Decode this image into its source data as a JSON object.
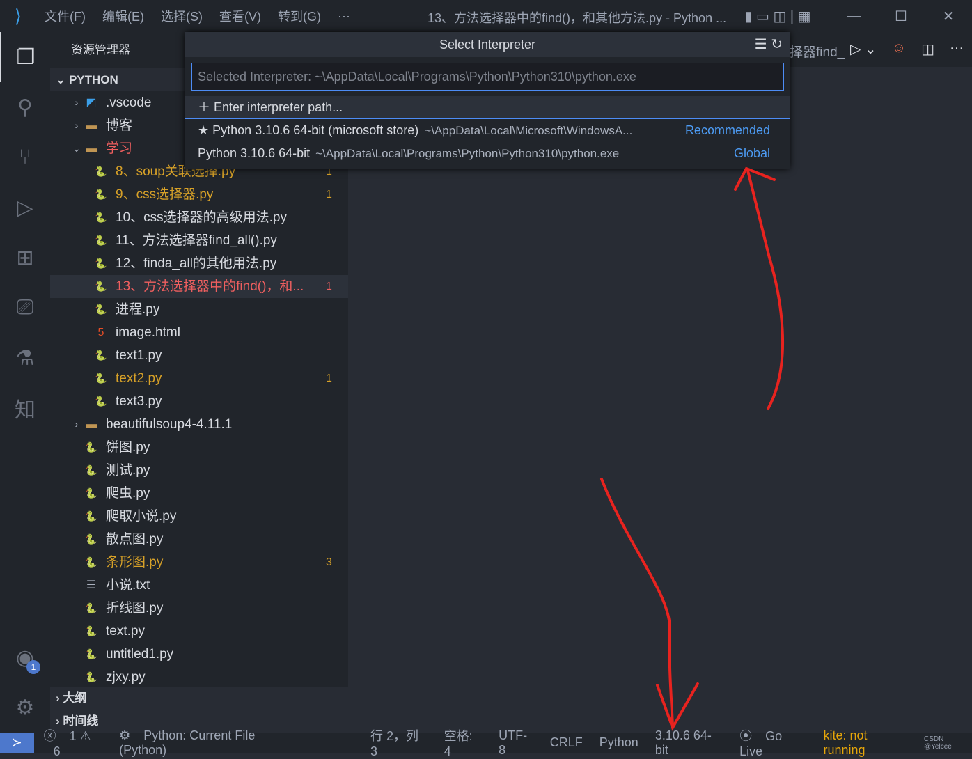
{
  "titlebar": {
    "menus": [
      "文件(F)",
      "编辑(E)",
      "选择(S)",
      "查看(V)",
      "转到(G)",
      "···"
    ],
    "title": "13、方法选择器中的find()，和其他方法.py - Python ..."
  },
  "sidebar": {
    "title": "资源管理器",
    "section": "PYTHON",
    "outline": "大纲",
    "timeline": "时间线",
    "items": [
      {
        "label": ".vscode",
        "type": "folder-vscode",
        "depth": 0,
        "chev": "›"
      },
      {
        "label": "博客",
        "type": "folder",
        "depth": 0,
        "chev": "›"
      },
      {
        "label": "学习",
        "type": "folder-open",
        "depth": 0,
        "chev": "⌄",
        "cls": "err"
      },
      {
        "label": "8、soup关联选择.py",
        "type": "python",
        "depth": 1,
        "badge": "1",
        "cls": "mod"
      },
      {
        "label": "9、css选择器.py",
        "type": "python",
        "depth": 1,
        "badge": "1",
        "cls": "mod"
      },
      {
        "label": "10、css选择器的高级用法.py",
        "type": "python",
        "depth": 1
      },
      {
        "label": "11、方法选择器find_all().py",
        "type": "python",
        "depth": 1
      },
      {
        "label": "12、finda_all的其他用法.py",
        "type": "python",
        "depth": 1
      },
      {
        "label": "13、方法选择器中的find()，和...",
        "type": "python",
        "depth": 1,
        "badge": "1",
        "cls": "err",
        "selected": true
      },
      {
        "label": "进程.py",
        "type": "python",
        "depth": 1
      },
      {
        "label": "image.html",
        "type": "html",
        "depth": 1
      },
      {
        "label": "text1.py",
        "type": "python",
        "depth": 1
      },
      {
        "label": "text2.py",
        "type": "python",
        "depth": 1,
        "badge": "1",
        "cls": "mod"
      },
      {
        "label": "text3.py",
        "type": "python",
        "depth": 1
      },
      {
        "label": "beautifulsoup4-4.11.1",
        "type": "folder",
        "depth": 0,
        "chev": "›"
      },
      {
        "label": "饼图.py",
        "type": "python",
        "depth": 0
      },
      {
        "label": "测试.py",
        "type": "python",
        "depth": 0
      },
      {
        "label": "爬虫.py",
        "type": "python",
        "depth": 0
      },
      {
        "label": "爬取小说.py",
        "type": "python",
        "depth": 0
      },
      {
        "label": "散点图.py",
        "type": "python",
        "depth": 0
      },
      {
        "label": "条形图.py",
        "type": "python",
        "depth": 0,
        "badge": "3",
        "cls": "mod"
      },
      {
        "label": "小说.txt",
        "type": "text",
        "depth": 0
      },
      {
        "label": "折线图.py",
        "type": "python",
        "depth": 0
      },
      {
        "label": "text.py",
        "type": "python",
        "depth": 0
      },
      {
        "label": "untitled1.py",
        "type": "python",
        "depth": 0
      },
      {
        "label": "zjxy.py",
        "type": "python",
        "depth": 0
      }
    ]
  },
  "editor": {
    "tab_partial": "择器find_"
  },
  "quickpick": {
    "title": "Select Interpreter",
    "placeholder": "Selected Interpreter: ~\\AppData\\Local\\Programs\\Python\\Python310\\python.exe",
    "enter_path": "Enter interpreter path...",
    "options": [
      {
        "label": "Python 3.10.6 64-bit (microsoft store)",
        "desc": "~\\AppData\\Local\\Microsoft\\WindowsA...",
        "tag": "Recommended",
        "icon": "star-icon"
      },
      {
        "label": "Python 3.10.6 64-bit",
        "desc": "~\\AppData\\Local\\Programs\\Python\\Python310\\python.exe",
        "tag": "Global"
      }
    ]
  },
  "activity": {
    "accounts_badge": "1"
  },
  "status": {
    "errors": "1",
    "warnings": "6",
    "run": "Python: Current File (Python)",
    "position": "行 2，列 3",
    "spaces": "空格: 4",
    "encoding": "UTF-8",
    "eol": "CRLF",
    "language": "Python",
    "interpreter": "3.10.6 64-bit",
    "golive": "Go Live",
    "kite": "kite: not running",
    "watermark": "CSDN @Yelcee"
  },
  "colors": {
    "accent": "#4d8cf5",
    "annotation": "#e8231f",
    "modified": "#d7a128",
    "error": "#ef5f5f"
  }
}
